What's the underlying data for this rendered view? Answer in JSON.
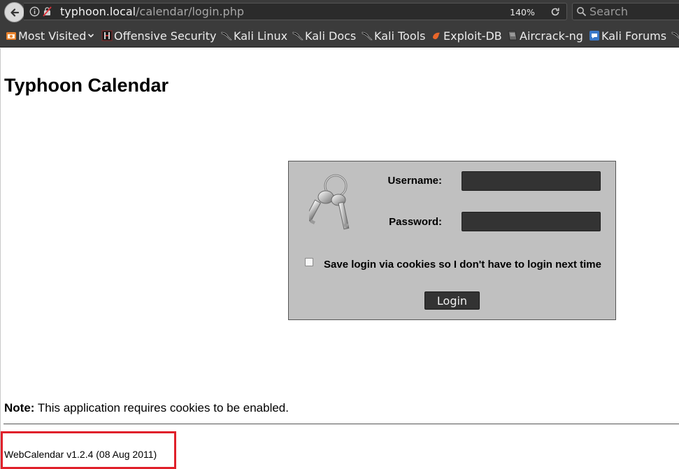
{
  "browser": {
    "url_host": "typhoon.local",
    "url_path": "/calendar/login.php",
    "zoom": "140%",
    "search_placeholder": "Search",
    "bookmarks": [
      {
        "label": "Most Visited",
        "icon": "most-visited-icon"
      },
      {
        "label": "Offensive Security",
        "icon": "offensive-security-icon"
      },
      {
        "label": "Kali Linux",
        "icon": "kali-dragon-icon"
      },
      {
        "label": "Kali Docs",
        "icon": "kali-dragon-icon"
      },
      {
        "label": "Kali Tools",
        "icon": "kali-dragon-icon"
      },
      {
        "label": "Exploit-DB",
        "icon": "exploit-db-icon"
      },
      {
        "label": "Aircrack-ng",
        "icon": "aircrack-icon"
      },
      {
        "label": "Kali Forums",
        "icon": "kali-forums-icon"
      }
    ]
  },
  "page": {
    "title": "Typhoon Calendar",
    "login": {
      "username_label": "Username:",
      "password_label": "Password:",
      "remember_label": "Save login via cookies so I don't have to login next time",
      "login_button": "Login"
    },
    "note_label": "Note:",
    "note_text": " This application requires cookies to be enabled.",
    "version": "WebCalendar v1.2.4 (08 Aug 2011)"
  },
  "colors": {
    "chrome_bg": "#3b3b3b",
    "login_panel_bg": "#c0c0c0",
    "input_bg": "#333333",
    "highlight_box": "#e0202a"
  }
}
